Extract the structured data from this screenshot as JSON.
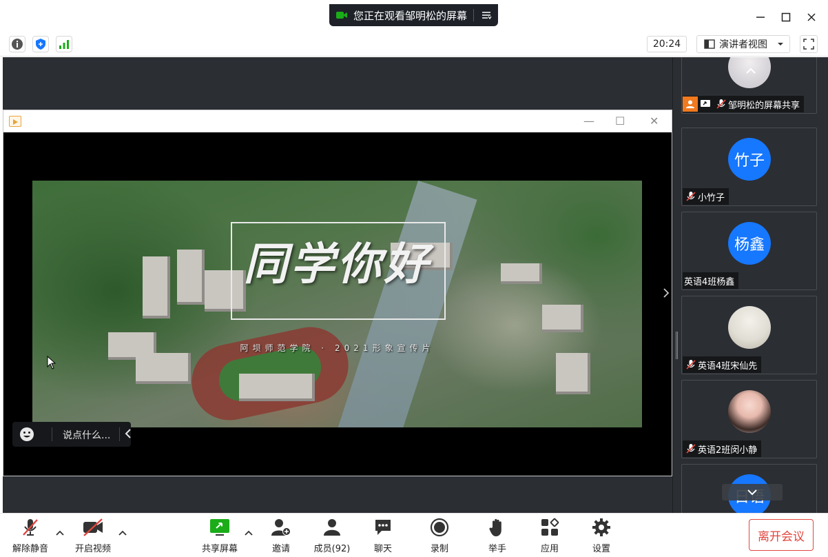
{
  "banner": {
    "text": "您正在观看邹明松的屏幕"
  },
  "header": {
    "clock": "20:24",
    "view_label": "演讲者视图"
  },
  "video": {
    "title": "同学你好",
    "subtitle": "阿坝师范学院 · 2021形象宣传片"
  },
  "chat": {
    "placeholder": "说点什么..."
  },
  "participants": [
    {
      "name": "邹明松的屏幕共享",
      "avatar": "",
      "muted": true
    },
    {
      "name": "小竹子",
      "avatar": "竹子",
      "muted": true
    },
    {
      "name": "英语4班杨鑫",
      "avatar": "杨鑫",
      "muted": false
    },
    {
      "name": "英语4班宋仙先",
      "avatar": "",
      "muted": true
    },
    {
      "name": "英语2班闵小静",
      "avatar": "",
      "muted": true
    },
    {
      "name": "",
      "avatar": "日语",
      "muted": false
    }
  ],
  "toolbar": {
    "unmute": "解除静音",
    "start_video": "开启视频",
    "share_screen": "共享屏幕",
    "invite": "邀请",
    "members": "成员(92)",
    "chat": "聊天",
    "record": "录制",
    "raise_hand": "举手",
    "apps": "应用",
    "settings": "设置",
    "leave": "离开会议"
  },
  "colors": {
    "accent_blue": "#1677ff",
    "leave_red": "#e1463e",
    "share_green": "#1aad19",
    "bg_dark": "#2b2e33"
  }
}
